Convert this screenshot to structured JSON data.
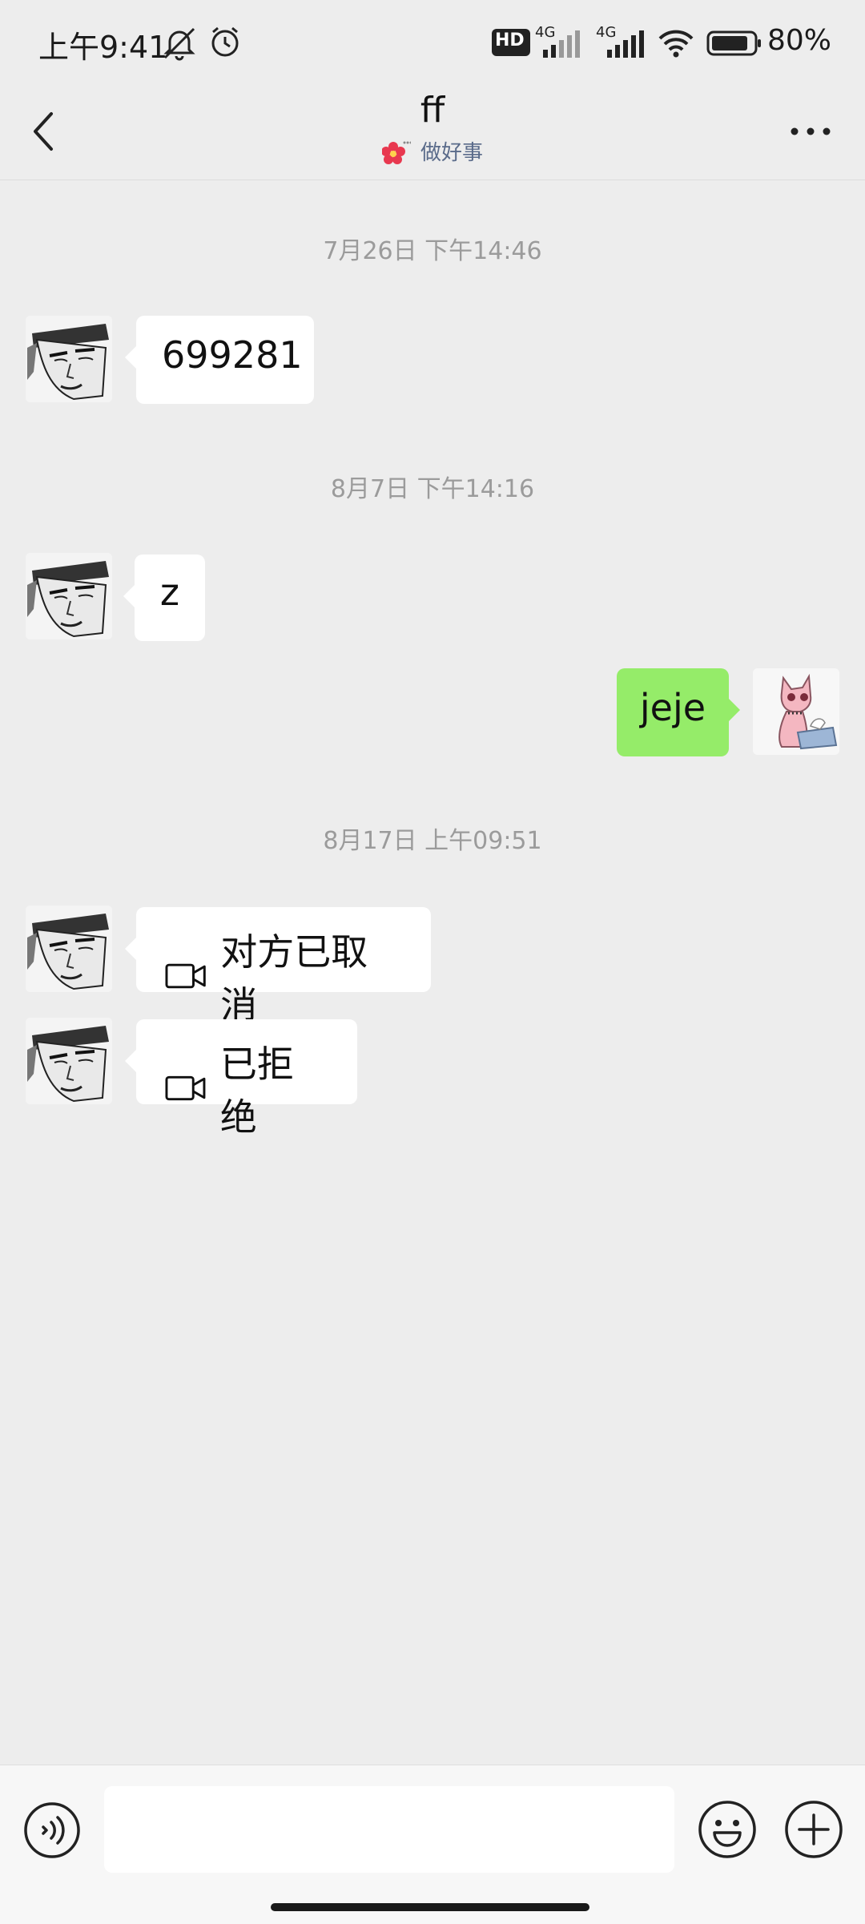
{
  "status_bar": {
    "time": "上午9:41",
    "battery": "80%",
    "network_1": "4G",
    "network_2": "4G",
    "hd_label": "HD"
  },
  "header": {
    "title": "ff",
    "status": "做好事"
  },
  "messages": [
    {
      "type": "timestamp",
      "text": "7月26日 下午14:46"
    },
    {
      "type": "incoming",
      "text": "699281"
    },
    {
      "type": "timestamp",
      "text": "8月7日 下午14:16"
    },
    {
      "type": "incoming",
      "text": "z"
    },
    {
      "type": "outgoing",
      "text": "jeje"
    },
    {
      "type": "timestamp",
      "text": "8月17日 上午09:51"
    },
    {
      "type": "incoming-call",
      "text": "对方已取消"
    },
    {
      "type": "incoming-call",
      "text": "已拒绝"
    }
  ],
  "input": {
    "value": "",
    "placeholder": ""
  },
  "icons": {
    "back": "chevron-left-icon",
    "more": "more-dots-icon",
    "voice": "voice-icon",
    "emoji": "emoji-icon",
    "plus": "plus-icon",
    "video_call": "video-call-icon"
  },
  "colors": {
    "background": "#ededed",
    "outgoing_bubble": "#95ec69",
    "incoming_bubble": "#ffffff",
    "status_text": "#5a6b8a"
  }
}
